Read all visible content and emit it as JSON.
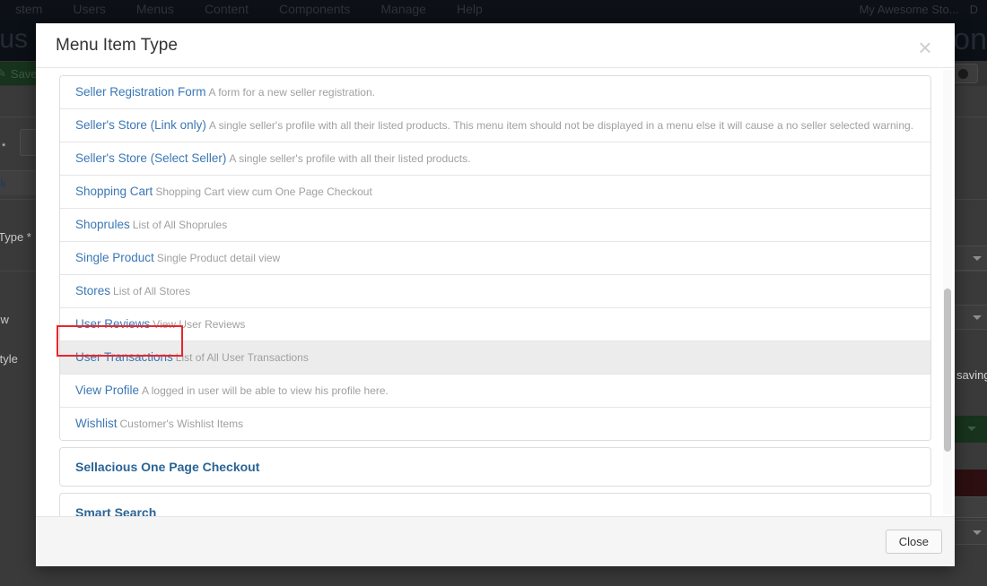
{
  "background": {
    "topnav": {
      "items": [
        "stem",
        "Users",
        "Menus",
        "Content",
        "Components",
        "Manage",
        "Help"
      ],
      "right_items": [
        "My Awesome Sto...",
        "D"
      ]
    },
    "page_title": "enus",
    "brand": "on",
    "toolbar": {
      "save_label": "Save",
      "save_icon": "pencil-icon",
      "globe_icon": "globe-icon"
    },
    "form_labels": [
      "*",
      "Link",
      "Type *",
      "dow",
      "Style"
    ],
    "status_text": "saving"
  },
  "modal": {
    "title": "Menu Item Type",
    "close_icon": "close-icon",
    "footer": {
      "close_label": "Close"
    },
    "types": [
      {
        "name": "Seller Registration Form",
        "desc": "A form for a new seller registration.",
        "hovered": false
      },
      {
        "name": "Seller's Store (Link only)",
        "desc": "A single seller's profile with all their listed products. This menu item should not be displayed in a menu else it will cause a no seller selected warning.",
        "hovered": false
      },
      {
        "name": "Seller's Store (Select Seller)",
        "desc": "A single seller's profile with all their listed products.",
        "hovered": false
      },
      {
        "name": "Shopping Cart",
        "desc": "Shopping Cart view cum One Page Checkout",
        "hovered": false
      },
      {
        "name": "Shoprules",
        "desc": "List of All Shoprules",
        "hovered": false
      },
      {
        "name": "Single Product",
        "desc": "Single Product detail view",
        "hovered": false
      },
      {
        "name": "Stores",
        "desc": "List of All Stores",
        "hovered": false
      },
      {
        "name": "User Reviews",
        "desc": "View User Reviews",
        "hovered": false
      },
      {
        "name": "User Transactions",
        "desc": "List of All User Transactions",
        "hovered": true
      },
      {
        "name": "View Profile",
        "desc": "A logged in user will be able to view his profile here.",
        "hovered": false
      },
      {
        "name": "Wishlist",
        "desc": "Customer's Wishlist Items",
        "hovered": false
      }
    ],
    "accordions": [
      {
        "label": "Sellacious One Page Checkout"
      },
      {
        "label": "Smart Search"
      }
    ]
  },
  "colors": {
    "link": "#3b77b5",
    "accordion": "#2a6496",
    "desc": "#a0a0a0",
    "highlight": "#e8262b",
    "hover_row": "#ececec"
  }
}
